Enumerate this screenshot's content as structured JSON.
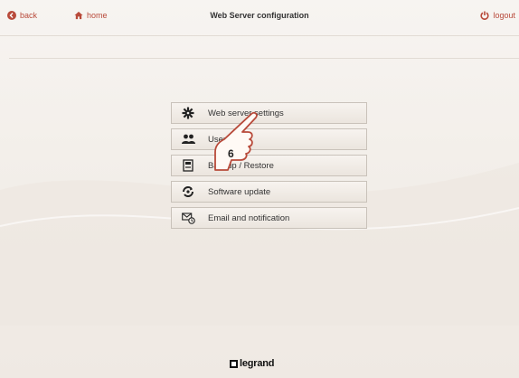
{
  "header": {
    "back_label": "back",
    "home_label": "home",
    "title": "Web Server configuration",
    "logout_label": "logout"
  },
  "menu": {
    "items": [
      {
        "label": "Web server settings",
        "icon": "gear-icon"
      },
      {
        "label": "Users",
        "icon": "users-icon"
      },
      {
        "label": "Backup / Restore",
        "icon": "backup-icon"
      },
      {
        "label": "Software update",
        "icon": "software-update-icon"
      },
      {
        "label": "Email and notification",
        "icon": "email-notification-icon"
      }
    ]
  },
  "overlay": {
    "step_number": "6"
  },
  "brand": {
    "logo_text": "legrand"
  },
  "colors": {
    "accent": "#b84a3a",
    "text": "#333333",
    "border": "#c9c2ba"
  }
}
